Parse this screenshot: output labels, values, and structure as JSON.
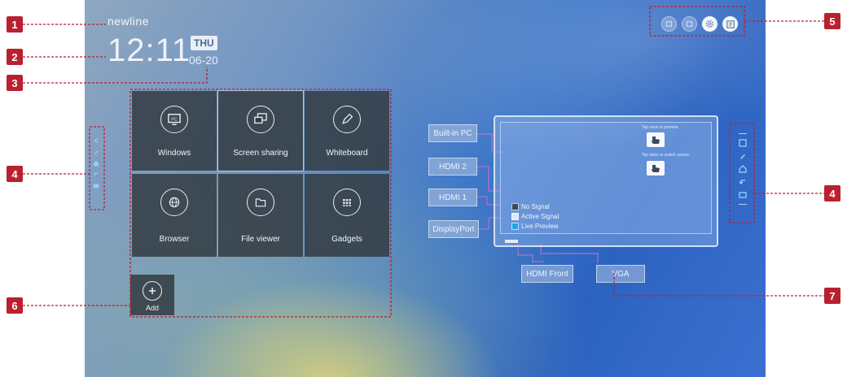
{
  "home": {
    "brand": "newline",
    "time": "12:11",
    "day": "THU",
    "date": "06-20"
  },
  "apps": [
    {
      "label": "Windows",
      "icon": "pc-icon"
    },
    {
      "label": "Screen sharing",
      "icon": "screen-share-icon"
    },
    {
      "label": "Whiteboard",
      "icon": "pen-icon"
    },
    {
      "label": "Browser",
      "icon": "globe-icon"
    },
    {
      "label": "File viewer",
      "icon": "folder-icon"
    },
    {
      "label": "Gadgets",
      "icon": "grid-icon"
    }
  ],
  "add_tile": {
    "label": "Add",
    "icon": "plus-icon"
  },
  "signal": {
    "hint_preview": "Tap once to preview",
    "hint_switch": "Tap twice to switch source",
    "legend": [
      {
        "label": "No Signal",
        "color": "#3a4a5c"
      },
      {
        "label": "Active Signal",
        "color": "#dfe9f7"
      },
      {
        "label": "Live Preview",
        "color": "#1fa3e8"
      }
    ],
    "sources": {
      "builtin_pc": "Built-in PC",
      "hdmi2": "HDMI 2",
      "hdmi1": "HDMI 1",
      "displayport": "DisplayPort",
      "hdmi_front": "HDMI Front",
      "vga": "VGA"
    }
  },
  "callouts": [
    "1",
    "2",
    "3",
    "4",
    "5",
    "6",
    "7"
  ],
  "colors": {
    "callout": "#b92030",
    "tile": "#343e44",
    "accent_blue": "#1fa3e8"
  }
}
